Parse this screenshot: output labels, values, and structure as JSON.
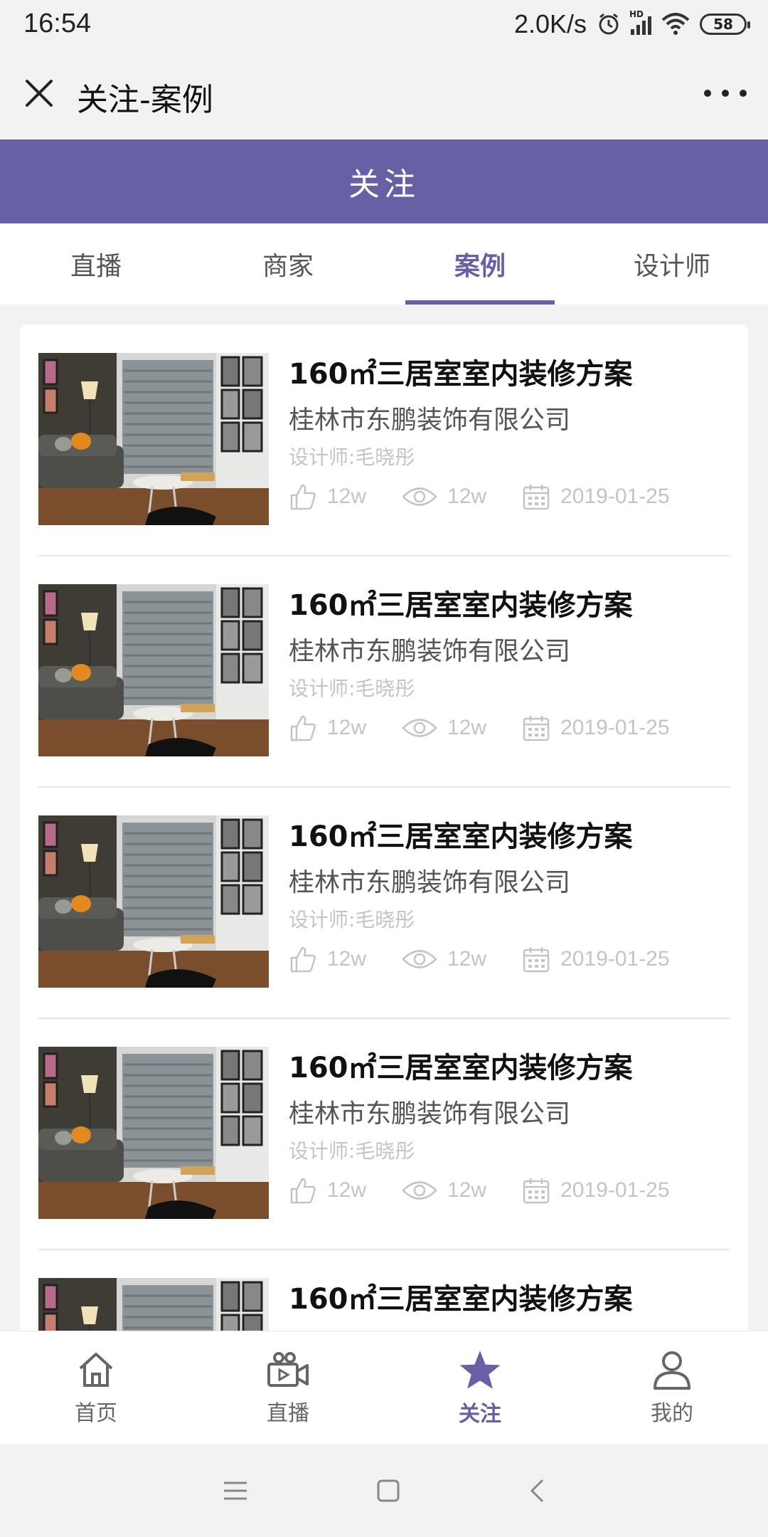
{
  "status_bar": {
    "time": "16:54",
    "speed": "2.0K/s",
    "network": "HD",
    "battery": "58"
  },
  "title_bar": {
    "title": "关注-案例"
  },
  "header": {
    "title": "关注"
  },
  "tabs": [
    {
      "label": "直播",
      "active": false
    },
    {
      "label": "商家",
      "active": false
    },
    {
      "label": "案例",
      "active": true
    },
    {
      "label": "设计师",
      "active": false
    }
  ],
  "items": [
    {
      "title": "160㎡三居室室内装修方案",
      "company": "桂林市东鹏装饰有限公司",
      "designer": "设计师:毛晓彤",
      "likes": "12w",
      "views": "12w",
      "date": "2019-01-25"
    },
    {
      "title": "160㎡三居室室内装修方案",
      "company": "桂林市东鹏装饰有限公司",
      "designer": "设计师:毛晓彤",
      "likes": "12w",
      "views": "12w",
      "date": "2019-01-25"
    },
    {
      "title": "160㎡三居室室内装修方案",
      "company": "桂林市东鹏装饰有限公司",
      "designer": "设计师:毛晓彤",
      "likes": "12w",
      "views": "12w",
      "date": "2019-01-25"
    },
    {
      "title": "160㎡三居室室内装修方案",
      "company": "桂林市东鹏装饰有限公司",
      "designer": "设计师:毛晓彤",
      "likes": "12w",
      "views": "12w",
      "date": "2019-01-25"
    },
    {
      "title": "160㎡三居室室内装修方案",
      "company": "",
      "designer": "",
      "likes": "",
      "views": "",
      "date": ""
    }
  ],
  "bottom_nav": [
    {
      "label": "首页",
      "icon": "home-icon",
      "active": false
    },
    {
      "label": "直播",
      "icon": "video-camera-icon",
      "active": false
    },
    {
      "label": "关注",
      "icon": "star-icon",
      "active": true
    },
    {
      "label": "我的",
      "icon": "user-icon",
      "active": false
    }
  ],
  "colors": {
    "accent": "#6760a4",
    "muted": "#c4c4c4",
    "background": "#f2f2f2"
  }
}
